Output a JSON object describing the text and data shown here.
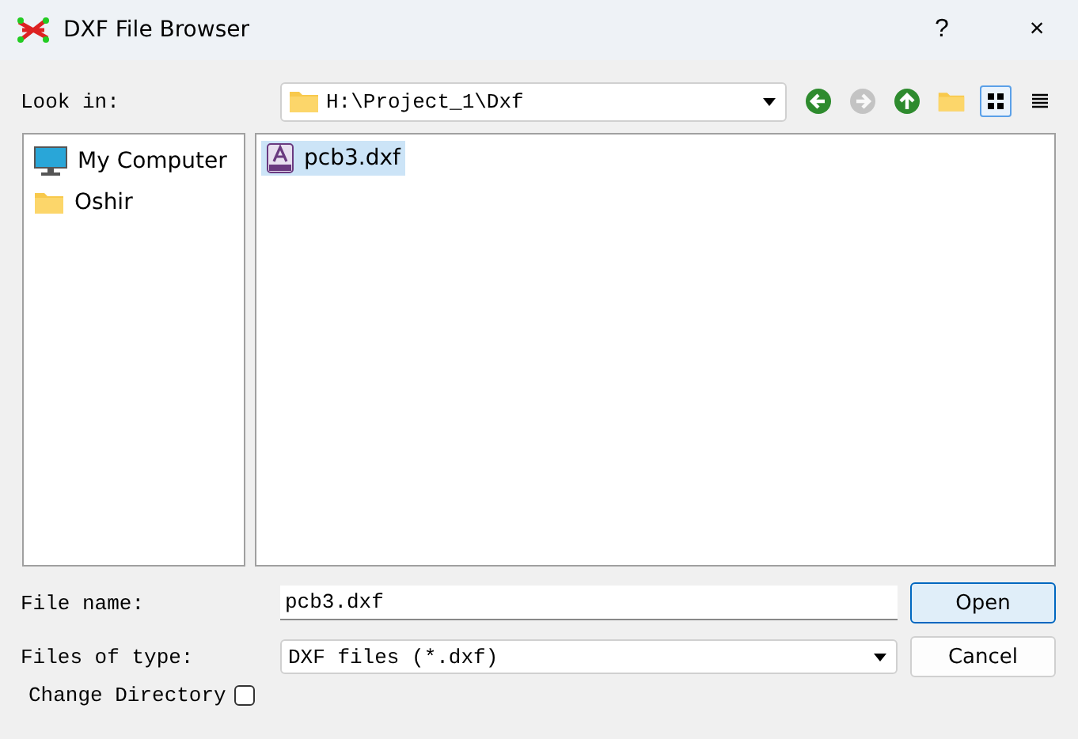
{
  "window": {
    "title": "DXF File Browser",
    "help": "?",
    "close": "×"
  },
  "look_in": {
    "label": "Look in:",
    "path": "H:\\Project_1\\Dxf"
  },
  "toolbar": [
    {
      "kind": "back",
      "disabled": false,
      "selected": false
    },
    {
      "kind": "forward",
      "disabled": true,
      "selected": false
    },
    {
      "kind": "up",
      "disabled": false,
      "selected": false
    },
    {
      "kind": "newfolder",
      "disabled": false,
      "selected": false
    },
    {
      "kind": "icons",
      "disabled": false,
      "selected": true
    },
    {
      "kind": "details",
      "disabled": false,
      "selected": false
    }
  ],
  "sidebar": {
    "items": [
      {
        "kind": "computer",
        "label": "My Computer"
      },
      {
        "kind": "folder",
        "label": "Oshir"
      }
    ]
  },
  "files": [
    {
      "label": "pcb3.dxf",
      "selected": true
    }
  ],
  "file_name": {
    "label": "File name:",
    "value": "pcb3.dxf"
  },
  "file_type": {
    "label": "Files of type:",
    "value": "DXF files (*.dxf)"
  },
  "change_directory": {
    "label": "Change Directory",
    "checked": false
  },
  "buttons": [
    {
      "label": "Open",
      "default": true
    },
    {
      "label": "Cancel",
      "default": false
    }
  ]
}
